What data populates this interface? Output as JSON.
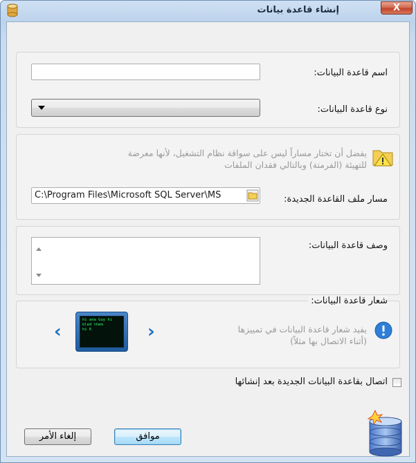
{
  "window": {
    "title": "إنشاء قاعدة بيانات",
    "close_glyph": "X"
  },
  "fields": {
    "db_name_label": "اسم قاعدة البيانات:",
    "db_name_value": "",
    "db_type_label": "نوع قاعدة البيانات:",
    "db_type_value": "",
    "path_label": "مسار ملف القاعدة الجديدة:",
    "path_value": "C:\\Program Files\\Microsoft SQL Server\\MS",
    "description_label": "وصف قاعدة البيانات:",
    "description_value": "",
    "logo_label": "شعار قاعدة البيانات:"
  },
  "hints": {
    "path_warning_line1": "يفضل أن تختار مساراً ليس على سواقة نظام التشغيل، لأنها معرضة",
    "path_warning_line2": "للتهيئة (الفرمتة) وبالتالي فقدان الملفات",
    "logo_info_line1": "يفيد شعار قاعدة البيانات في تمييزها",
    "logo_info_line2": "(أثناء الاتصال بها مثلاً)"
  },
  "logo_preview": {
    "line1": "hi ana Guy hi",
    "line2": "bled them",
    "line3": "hi 6"
  },
  "options": {
    "connect_after_create_label": "اتصال بقاعدة البيانات الجديدة بعد إنشائها",
    "connect_after_create_checked": false
  },
  "buttons": {
    "ok_label": "موافق",
    "cancel_label": "إلغاء الأمر"
  },
  "colors": {
    "accent": "#1f6fc0",
    "hint_text": "#9a9a9a",
    "close_button": "#c2432a"
  }
}
